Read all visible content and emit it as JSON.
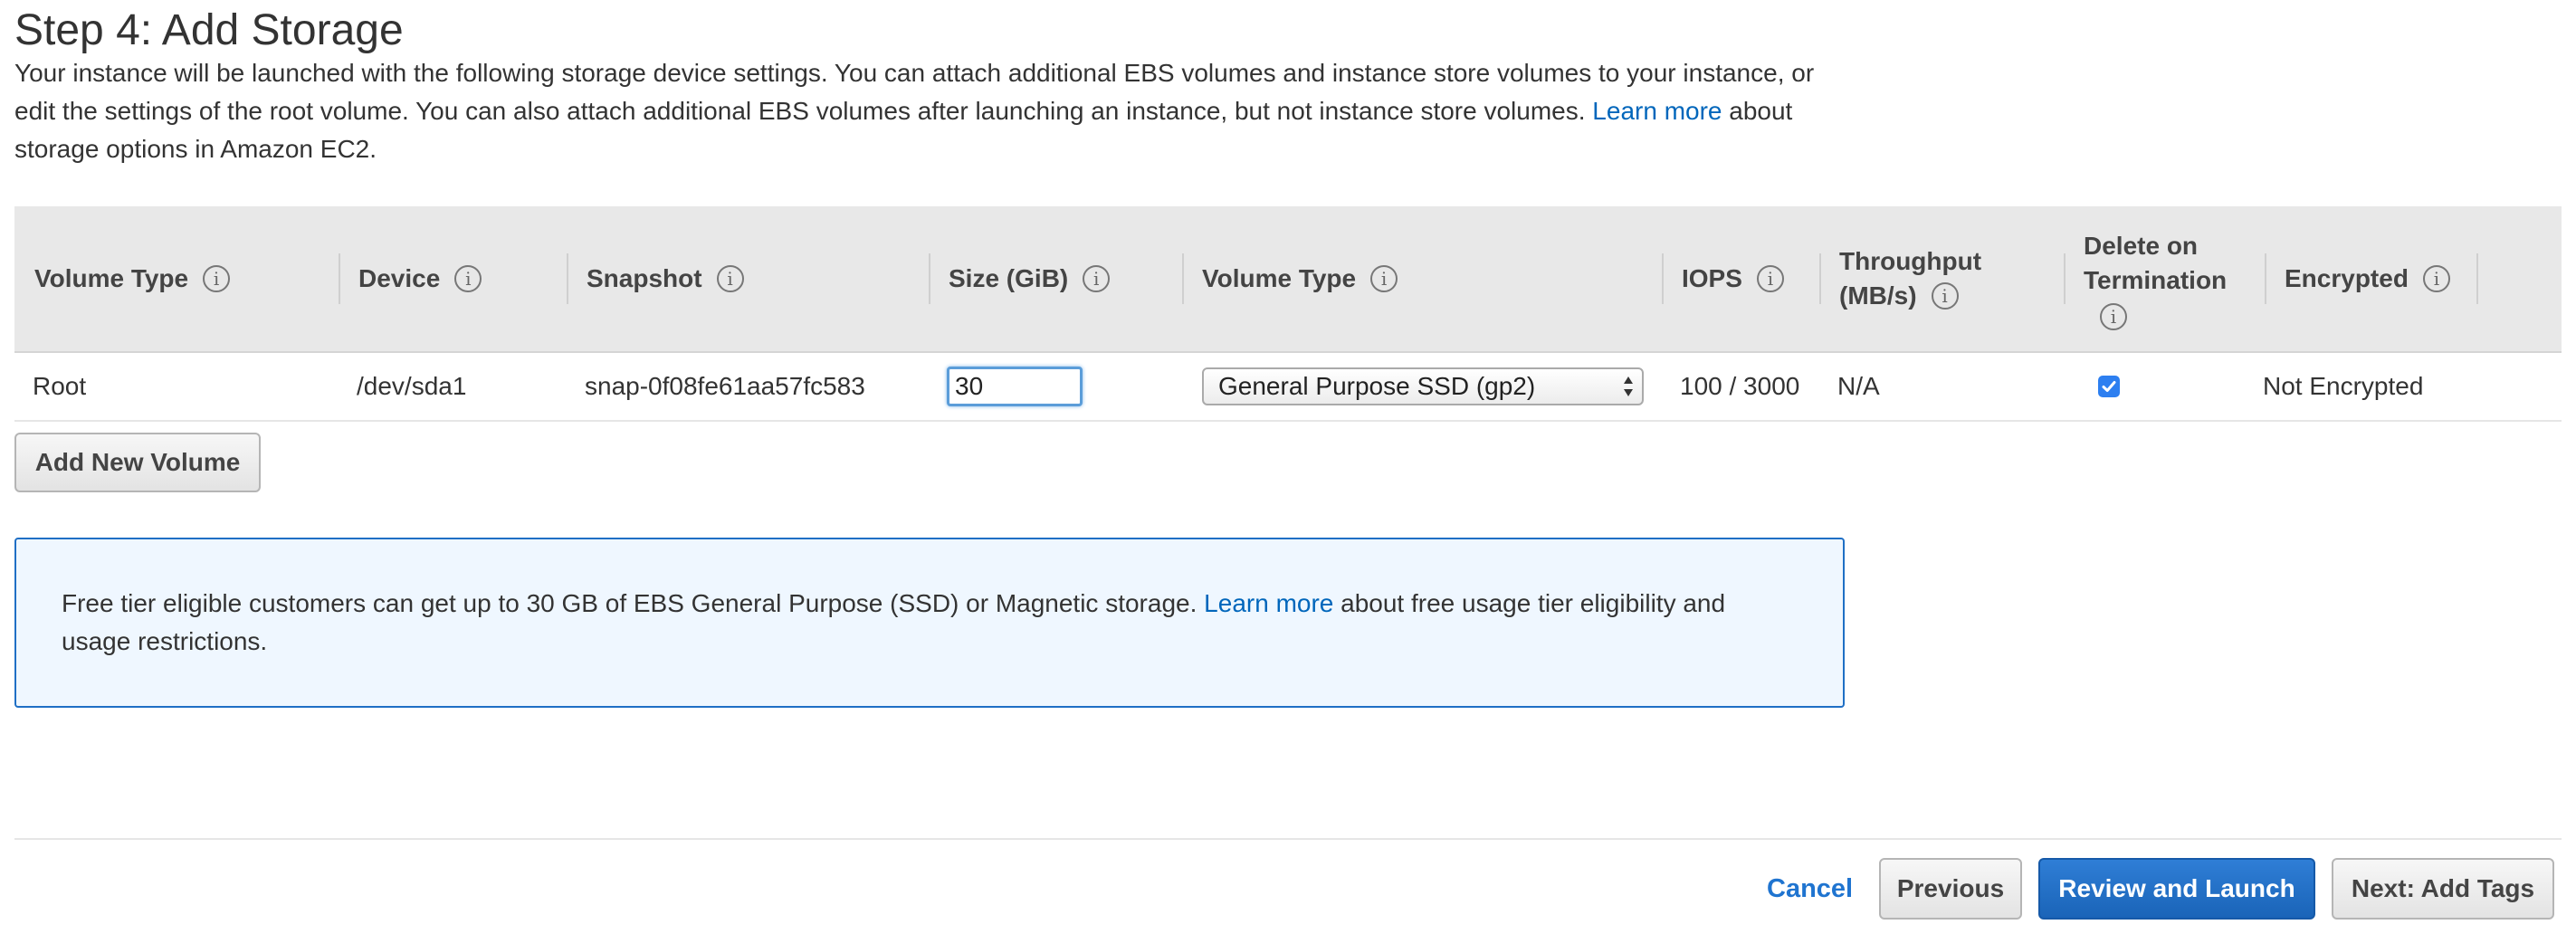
{
  "page": {
    "title": "Step 4: Add Storage",
    "description_part1": "Your instance will be launched with the following storage device settings. You can attach additional EBS volumes and instance store volumes to your instance, or edit the settings of the root volume. You can also attach additional EBS volumes after launching an instance, but not instance store volumes. ",
    "description_link": "Learn more",
    "description_part2": " about storage options in Amazon EC2."
  },
  "table": {
    "headers": {
      "volume_type": "Volume Type",
      "device": "Device",
      "snapshot": "Snapshot",
      "size": "Size (GiB)",
      "volume_type2": "Volume Type",
      "iops": "IOPS",
      "throughput_line1": "Throughput",
      "throughput_line2": "(MB/s)",
      "delete_line1": "Delete on",
      "delete_line2": "Termination",
      "encrypted": "Encrypted"
    },
    "info_glyph": "i",
    "row": {
      "volume_type": "Root",
      "device": "/dev/sda1",
      "snapshot": "snap-0f08fe61aa57fc583",
      "size": "30",
      "ebs_volume_type": "General Purpose SSD (gp2)",
      "iops": "100 / 3000",
      "throughput": "N/A",
      "delete_on_termination": true,
      "encrypted": "Not Encrypted"
    }
  },
  "add_volume_button": "Add New Volume",
  "free_tier": {
    "text_part1": "Free tier eligible customers can get up to 30 GB of EBS General Purpose (SSD) or Magnetic storage. ",
    "link": "Learn more",
    "text_part2": " about free usage tier eligibility and usage restrictions."
  },
  "footer": {
    "cancel": "Cancel",
    "previous": "Previous",
    "review_launch": "Review and Launch",
    "next": "Next: Add Tags"
  },
  "colors": {
    "link": "#0066bb",
    "primary_button": "#1a64b8",
    "info_border": "#1f6fc5",
    "info_background": "#eff7ff",
    "table_header": "#e8e8e8"
  },
  "icons": {
    "info": "info-circle-icon",
    "select_arrows": "up-down-arrows-icon",
    "checkbox": "checkmark-icon"
  }
}
